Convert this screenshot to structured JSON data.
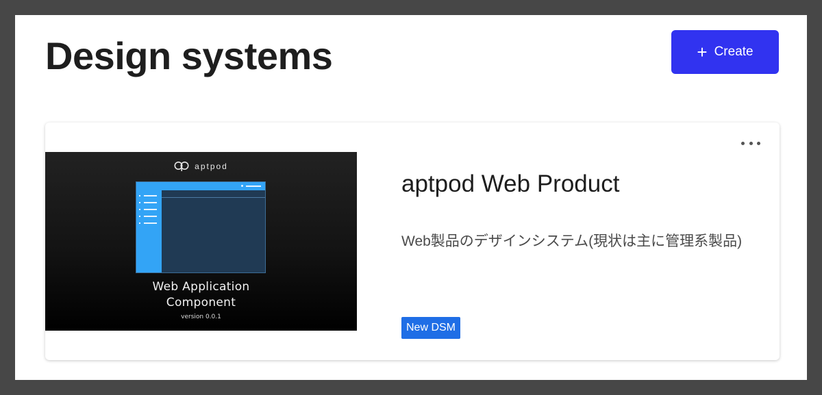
{
  "header": {
    "title": "Design systems",
    "create_label": "Create"
  },
  "card": {
    "title": "aptpod Web Product",
    "description": "Web製品のデザインシステム(現状は主に管理系製品)",
    "badge": "New DSM",
    "thumbnail": {
      "logo_text": "aptpod",
      "title_line1": "Web Application",
      "title_line2": "Component",
      "version": "version 0.0.1"
    }
  },
  "colors": {
    "accent": "#3133f0",
    "badge": "#1f6ee6",
    "mock_primary": "#33a4f6"
  },
  "icons": {
    "create": "plus-icon",
    "more": "more-horizontal-icon"
  }
}
